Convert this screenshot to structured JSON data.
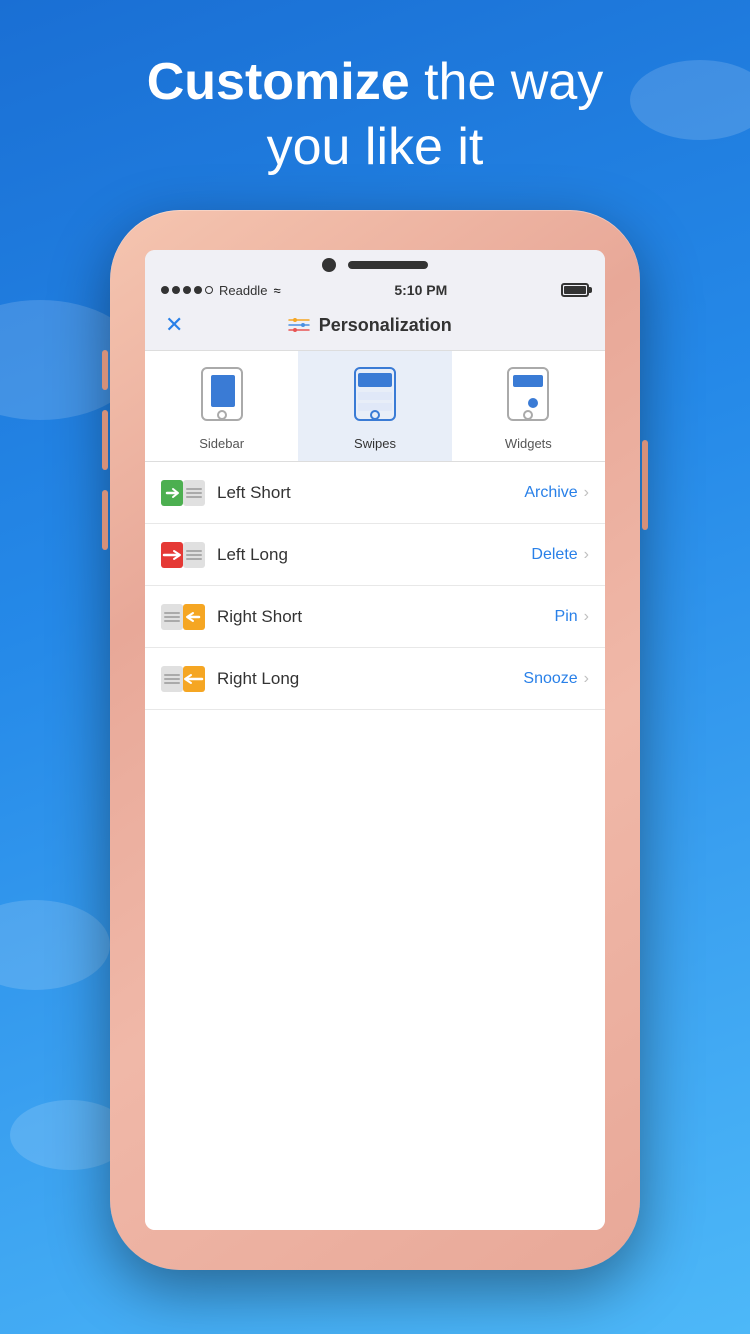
{
  "page": {
    "background_title": {
      "line1_bold": "Customize",
      "line1_light": " the way",
      "line2": "you like it"
    },
    "status_bar": {
      "carrier": "Readdle",
      "time": "5:10 PM",
      "wifi": "wifi"
    },
    "nav": {
      "close_label": "✕",
      "title": "Personalization"
    },
    "tabs": [
      {
        "id": "sidebar",
        "label": "Sidebar",
        "active": false
      },
      {
        "id": "swipes",
        "label": "Swipes",
        "active": true
      },
      {
        "id": "widgets",
        "label": "Widgets",
        "active": false
      }
    ],
    "swipe_rows": [
      {
        "id": "left-short",
        "label": "Left Short",
        "value": "Archive",
        "icon_type": "left-short"
      },
      {
        "id": "left-long",
        "label": "Left Long",
        "value": "Delete",
        "icon_type": "left-long"
      },
      {
        "id": "right-short",
        "label": "Right Short",
        "value": "Pin",
        "icon_type": "right-short"
      },
      {
        "id": "right-long",
        "label": "Right Long",
        "value": "Snooze",
        "icon_type": "right-long"
      }
    ]
  }
}
